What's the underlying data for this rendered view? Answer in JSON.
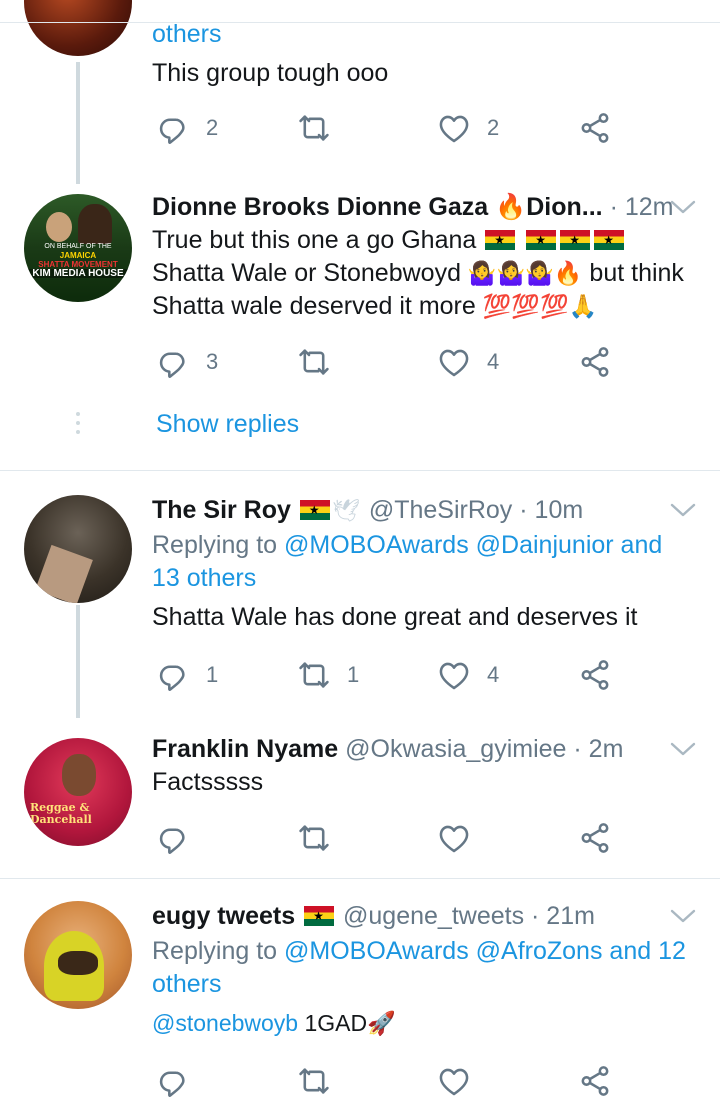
{
  "tweets": [
    {
      "reply_tail": "others",
      "text": "This group tough ooo",
      "reply_count": "2",
      "retweet_count": "",
      "like_count": "2"
    },
    {
      "name": "Dionne Brooks Dionne Gaza 🔥Dion...",
      "time": "· 12m",
      "text_parts": [
        "True but this one a go Ghana ",
        "Shatta Wale or Stonebwoyd ",
        " but think Shatta wale deserved it more "
      ],
      "emoji_shrug": "🤷‍♀️",
      "emoji_fire": "🔥",
      "emoji_100": "💯",
      "emoji_pray": "🙏",
      "reply_count": "3",
      "retweet_count": "",
      "like_count": "4",
      "avatar_text": {
        "l1": "ON BEHALF OF THE",
        "l2": "JAMAICA",
        "l3": "SHATTA MOVEMENT",
        "l4": "KIM MEDIA HOUSE"
      },
      "show_replies": "Show replies"
    },
    {
      "name": "The Sir Roy",
      "handle": "@TheSirRoy",
      "time": "· 10m",
      "reply_prefix": "Replying to ",
      "reply_links": "@MOBOAwards @Dainjunior",
      "reply_and": " and",
      "reply_others": "13 others",
      "text": "Shatta Wale has done great and deserves it",
      "reply_count": "1",
      "retweet_count": "1",
      "like_count": "4"
    },
    {
      "name": "Franklin Nyame",
      "handle": "@Okwasia_gyimiee",
      "time": "· 2m",
      "text": "Factsssss",
      "reply_count": "",
      "retweet_count": "",
      "like_count": "",
      "avatar_text": "Reggae & Dancehall"
    },
    {
      "name": "eugy tweets",
      "handle": "@ugene_tweets",
      "time": "· 21m",
      "reply_prefix": "Replying to ",
      "reply_links": "@MOBOAwards @AfroZons",
      "reply_and": " and 12",
      "reply_others": "others",
      "mention": "@stonebwoyb",
      "text": " 1GAD",
      "emoji_rocket": "🚀",
      "reply_count": "",
      "retweet_count": "",
      "like_count": ""
    }
  ],
  "colors": {
    "link": "#1b95e0",
    "muted": "#657786",
    "divider": "#e1e8ed",
    "thread": "#cfd9de"
  },
  "icons": [
    "reply-icon",
    "retweet-icon",
    "like-icon",
    "share-icon",
    "chevron-down-icon",
    "ghana-flag-icon",
    "dove-icon"
  ]
}
